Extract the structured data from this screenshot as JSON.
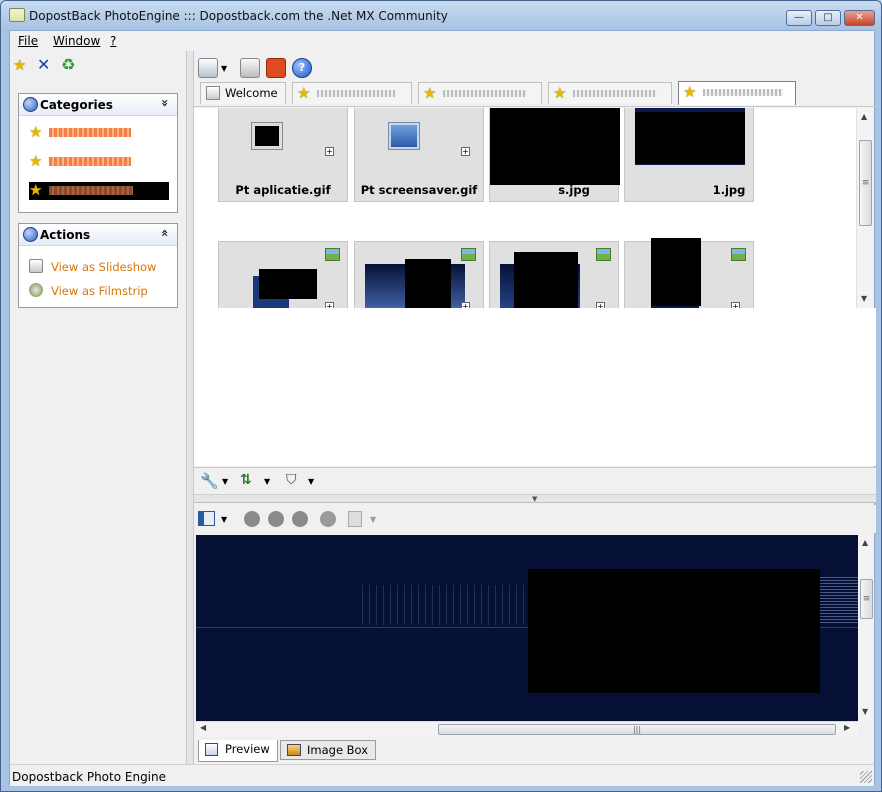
{
  "window": {
    "title": "DopostBack PhotoEngine ::: Dopostback.com the .Net MX Community",
    "controls": {
      "minimize": "—",
      "maximize": "□",
      "close": "✕"
    }
  },
  "menu": {
    "items": [
      "File",
      "Window",
      "?"
    ]
  },
  "left": {
    "toolbar": [
      "star-icon",
      "close-x-icon",
      "refresh-icon"
    ],
    "categories": {
      "title": "Categories",
      "chevron": "»"
    },
    "actions": {
      "title": "Actions",
      "chevron": "«",
      "items": [
        "View as Slideshow",
        "View as Filmstrip"
      ]
    }
  },
  "tabs": {
    "welcome": "Welcome"
  },
  "thumbnails": {
    "row1": [
      "Pt aplicatie.gif",
      "Pt screensaver.gif",
      "s.jpg",
      "1.jpg"
    ],
    "plus": "+"
  },
  "preview_tabs": [
    "Preview",
    "Image Box"
  ],
  "scroll": {
    "h_grip": "|||",
    "v_grip": "≡"
  },
  "status": {
    "text": "Dopostback Photo Engine"
  },
  "colors": {
    "accent_link": "#d9760a",
    "preview_bg": "#061034"
  }
}
